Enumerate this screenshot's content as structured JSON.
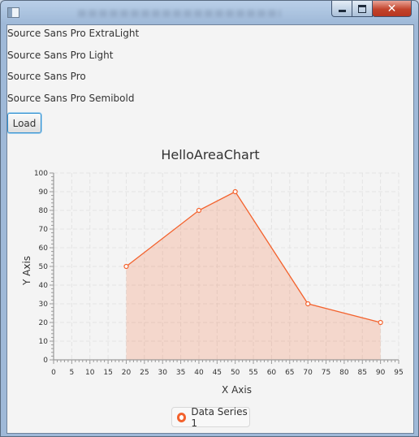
{
  "window": {
    "title": "",
    "controls": {
      "minimize_icon": "minimize-icon",
      "maximize_icon": "maximize-icon",
      "close_icon": "close-icon",
      "close_glyph": "✕"
    }
  },
  "fonts": [
    "Source Sans Pro ExtraLight",
    "Source Sans Pro Light",
    "Source Sans Pro",
    "Source Sans Pro Semibold"
  ],
  "load_button": {
    "label": "Load"
  },
  "chart_data": {
    "type": "area",
    "title": "HelloAreaChart",
    "xlabel": "X Axis",
    "ylabel": "Y Axis",
    "xlim": [
      0,
      95
    ],
    "ylim": [
      0,
      100
    ],
    "x_ticks": [
      0,
      5,
      10,
      15,
      20,
      25,
      30,
      35,
      40,
      45,
      50,
      55,
      60,
      65,
      70,
      75,
      80,
      85,
      90,
      95
    ],
    "y_ticks": [
      0,
      10,
      20,
      30,
      40,
      50,
      60,
      70,
      80,
      90,
      100
    ],
    "grid": true,
    "legend_position": "bottom",
    "series": [
      {
        "name": "Data Series 1",
        "color": "#f3622d",
        "points": [
          {
            "x": 20,
            "y": 50
          },
          {
            "x": 40,
            "y": 80
          },
          {
            "x": 50,
            "y": 90
          },
          {
            "x": 70,
            "y": 30
          },
          {
            "x": 90,
            "y": 20
          }
        ]
      }
    ]
  }
}
